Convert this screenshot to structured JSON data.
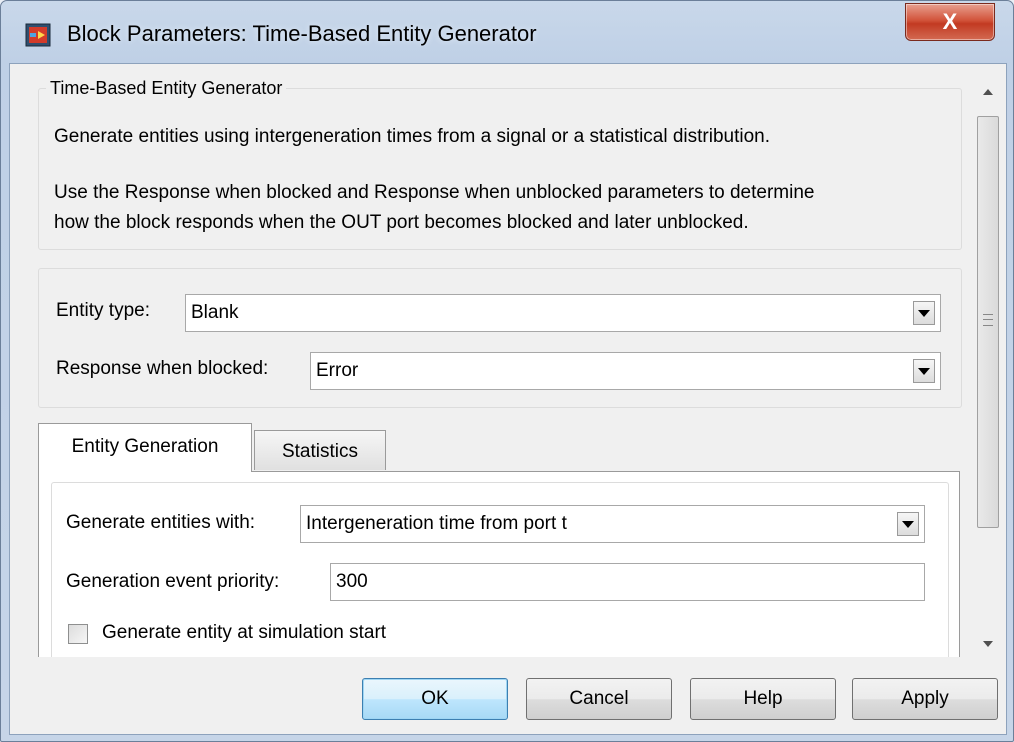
{
  "window": {
    "title": "Block Parameters: Time-Based Entity Generator",
    "close_glyph": "X"
  },
  "description": {
    "group_title": "Time-Based Entity Generator",
    "line1": "Generate entities using intergeneration times from a signal or a statistical distribution.",
    "line2": "Use the Response when blocked and Response when unblocked parameters to determine",
    "line3": "how the block responds when the OUT port becomes blocked and later unblocked."
  },
  "params": {
    "entity_type_label": "Entity type:",
    "entity_type_value": "Blank",
    "response_label": "Response when blocked:",
    "response_value": "Error"
  },
  "tabs": [
    {
      "label": "Entity Generation",
      "active": true
    },
    {
      "label": "Statistics",
      "active": false
    }
  ],
  "entity_generation": {
    "generate_with_label": "Generate entities with:",
    "generate_with_value": "Intergeneration time from port t",
    "priority_label": "Generation event priority:",
    "priority_value": "300",
    "sim_start_label": "Generate entity at simulation start",
    "sim_start_checked": false
  },
  "buttons": {
    "ok": "OK",
    "cancel": "Cancel",
    "help": "Help",
    "apply": "Apply"
  },
  "icons": [
    "simulink-block-icon",
    "close-icon",
    "chevron-down-icon",
    "scroll-up-icon",
    "scroll-down-icon"
  ],
  "colors": {
    "close_button": "#c23a22",
    "default_button_border": "#3c7fb1"
  }
}
